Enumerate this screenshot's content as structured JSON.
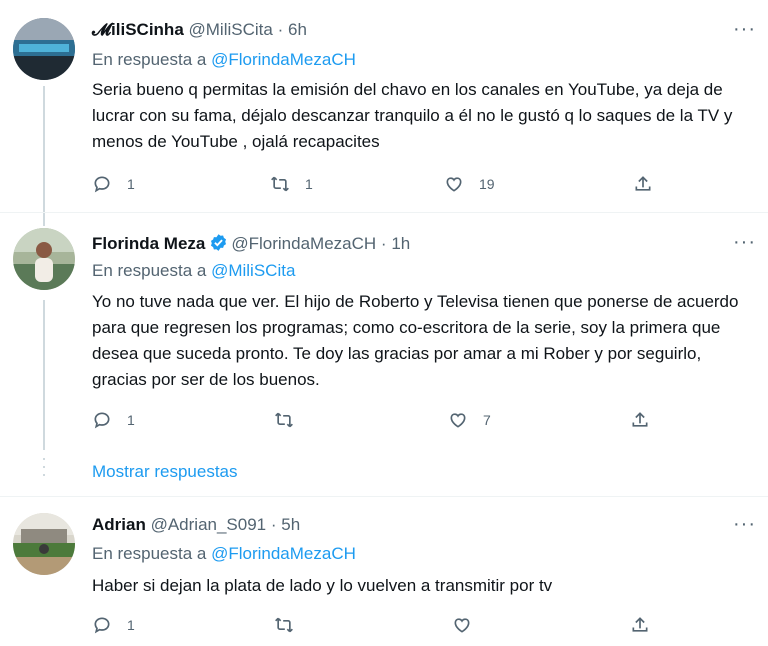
{
  "tweets": [
    {
      "name": "𝓜iliSCinha",
      "handle": "@MiliSCita",
      "dot": "·",
      "time": "6h",
      "reply_prefix": "En respuesta a ",
      "reply_to": "@FlorindaMezaCH",
      "text": "Seria bueno q permitas la emisión del chavo en los canales en YouTube, ya deja de lucrar con su fama, déjalo descanzar tranquilo a él no le gustó q lo saques de la TV y menos de YouTube , ojalá recapacites",
      "replies": "1",
      "retweets": "1",
      "likes": "19",
      "verified": false
    },
    {
      "name": "Florinda Meza",
      "handle": "@FlorindaMezaCH",
      "dot": "·",
      "time": "1h",
      "reply_prefix": "En respuesta a ",
      "reply_to": "@MiliSCita",
      "text": "Yo no tuve nada que ver. El hijo de Roberto y Televisa tienen  que ponerse de acuerdo para que regresen los programas; como  co-escritora de la serie, soy la primera que desea que suceda pronto. Te doy las gracias por amar a mi Rober y por seguirlo, gracias por ser de los buenos.",
      "replies": "1",
      "retweets": "",
      "likes": "7",
      "verified": true
    },
    {
      "name": "Adrian",
      "handle": "@Adrian_S091",
      "dot": "·",
      "time": "5h",
      "reply_prefix": "En respuesta a ",
      "reply_to": "@FlorindaMezaCH",
      "text": "Haber si dejan la plata de lado y lo vuelven a transmitir por tv",
      "replies": "1",
      "retweets": "",
      "likes": "",
      "verified": false
    }
  ],
  "show_replies_label": "Mostrar respuestas",
  "more_label": "···",
  "icons": [
    "reply-icon",
    "retweet-icon",
    "like-icon",
    "share-icon",
    "verified-badge-icon",
    "more-options-icon"
  ],
  "colors": {
    "accent": "#1d9bf0",
    "secondary_text": "#536471",
    "line": "#cfd9de"
  }
}
